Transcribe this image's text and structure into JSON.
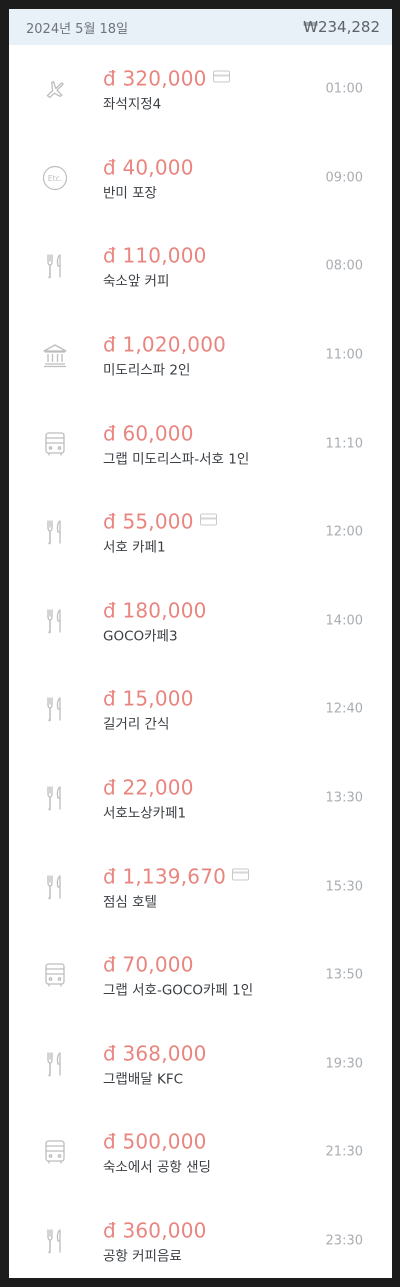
{
  "header": {
    "date": "2024년 5월 18일",
    "total": "₩234,282"
  },
  "colors": {
    "amount": "#e9857f",
    "header_bg": "#e9f1f8",
    "icon": "#bdbdbd"
  },
  "entries": [
    {
      "icon": "airplane-icon",
      "amount": "đ 320,000",
      "card": true,
      "memo": "좌석지정4",
      "time": "01:00"
    },
    {
      "icon": "etc-icon",
      "amount": "đ 40,000",
      "card": false,
      "memo": "반미 포장",
      "time": "09:00"
    },
    {
      "icon": "fork-knife-icon",
      "amount": "đ 110,000",
      "card": false,
      "memo": "숙소앞 커피",
      "time": "08:00"
    },
    {
      "icon": "bank-icon",
      "amount": "đ 1,020,000",
      "card": false,
      "memo": "미도리스파 2인",
      "time": "11:00"
    },
    {
      "icon": "bus-icon",
      "amount": "đ 60,000",
      "card": false,
      "memo": "그랩 미도리스파-서호 1인",
      "time": "11:10"
    },
    {
      "icon": "fork-knife-icon",
      "amount": "đ 55,000",
      "card": true,
      "memo": "서호 카페1",
      "time": "12:00"
    },
    {
      "icon": "fork-knife-icon",
      "amount": "đ 180,000",
      "card": false,
      "memo": "GOCO카페3",
      "time": "14:00"
    },
    {
      "icon": "fork-knife-icon",
      "amount": "đ 15,000",
      "card": false,
      "memo": "길거리 간식",
      "time": "12:40"
    },
    {
      "icon": "fork-knife-icon",
      "amount": "đ 22,000",
      "card": false,
      "memo": "서호노상카페1",
      "time": "13:30"
    },
    {
      "icon": "fork-knife-icon",
      "amount": "đ 1,139,670",
      "card": true,
      "memo": "점심 호텔",
      "time": "15:30"
    },
    {
      "icon": "bus-icon",
      "amount": "đ 70,000",
      "card": false,
      "memo": "그랩 서호-GOCO카페 1인",
      "time": "13:50"
    },
    {
      "icon": "fork-knife-icon",
      "amount": "đ 368,000",
      "card": false,
      "memo": "그랩배달 KFC",
      "time": "19:30"
    },
    {
      "icon": "bus-icon",
      "amount": "đ 500,000",
      "card": false,
      "memo": "숙소에서 공항 샌딩",
      "time": "21:30"
    },
    {
      "icon": "fork-knife-icon",
      "amount": "đ 360,000",
      "card": false,
      "memo": "공항 커피음료",
      "time": "23:30"
    }
  ]
}
